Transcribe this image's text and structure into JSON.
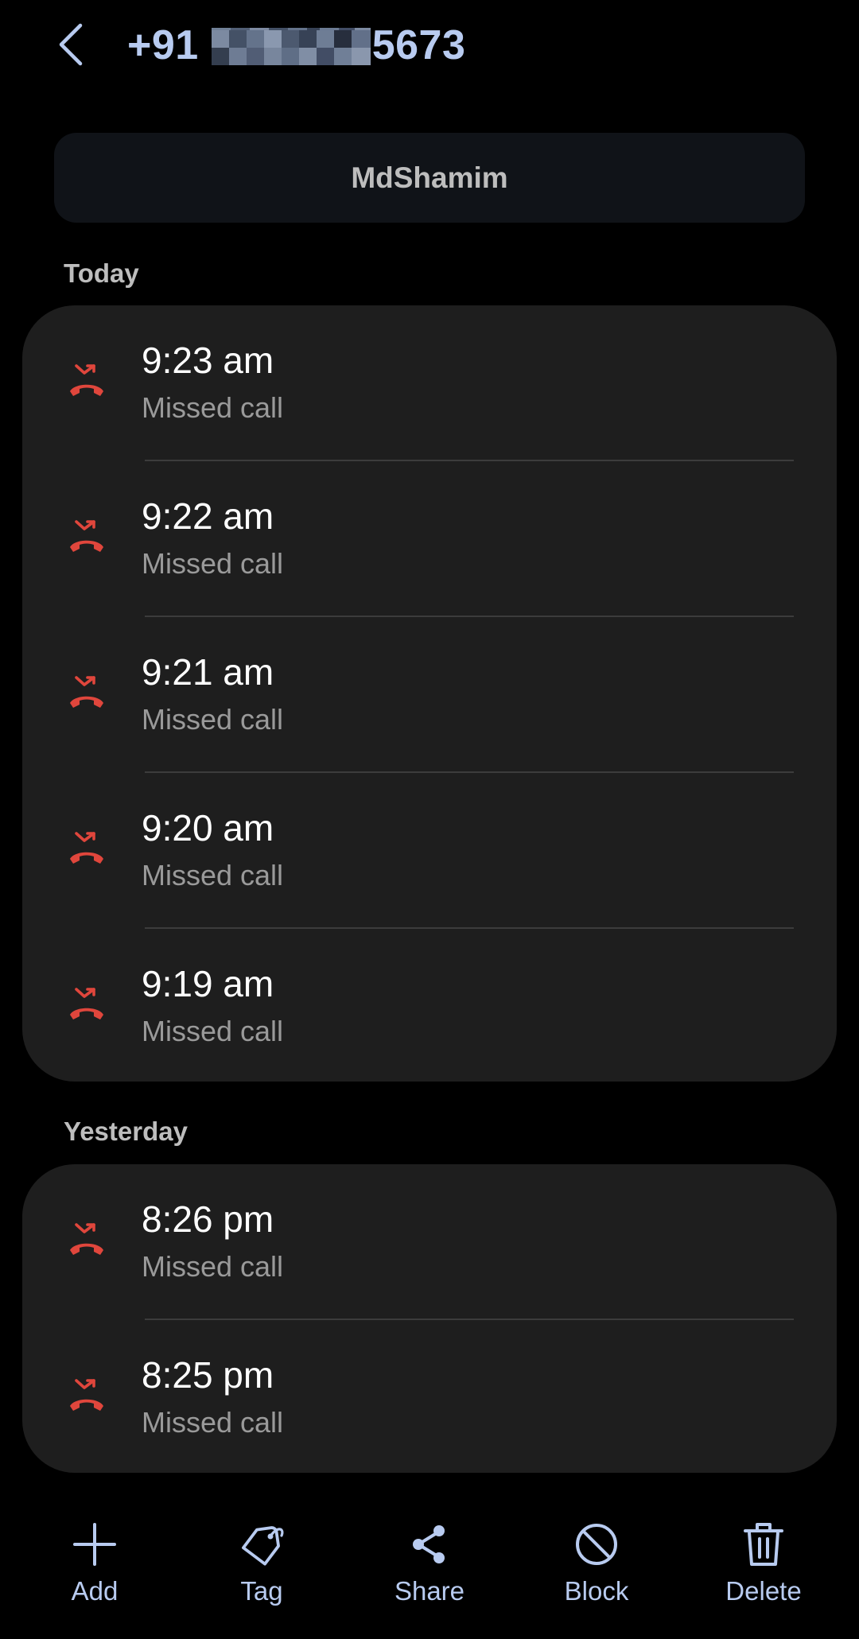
{
  "header": {
    "title_prefix": "+91",
    "title_suffix": "5673"
  },
  "contact": {
    "name": "MdShamim"
  },
  "sections": [
    {
      "label": "Today",
      "calls": [
        {
          "time": "9:23 am",
          "status": "Missed call"
        },
        {
          "time": "9:22 am",
          "status": "Missed call"
        },
        {
          "time": "9:21 am",
          "status": "Missed call"
        },
        {
          "time": "9:20 am",
          "status": "Missed call"
        },
        {
          "time": "9:19 am",
          "status": "Missed call"
        }
      ]
    },
    {
      "label": "Yesterday",
      "calls": [
        {
          "time": "8:26 pm",
          "status": "Missed call"
        },
        {
          "time": "8:25 pm",
          "status": "Missed call"
        }
      ]
    }
  ],
  "toolbar": {
    "add": "Add",
    "tag": "Tag",
    "share": "Share",
    "block": "Block",
    "delete": "Delete"
  },
  "colors": {
    "accent": "#b8cbf0",
    "missed": "#e0463c",
    "card": "#1e1e1e",
    "background": "#000000"
  },
  "icons": {
    "back": "chevron-left-icon",
    "missed": "missed-call-icon",
    "add": "plus-icon",
    "tag": "tag-icon",
    "share": "share-icon",
    "block": "block-icon",
    "delete": "trash-icon"
  }
}
